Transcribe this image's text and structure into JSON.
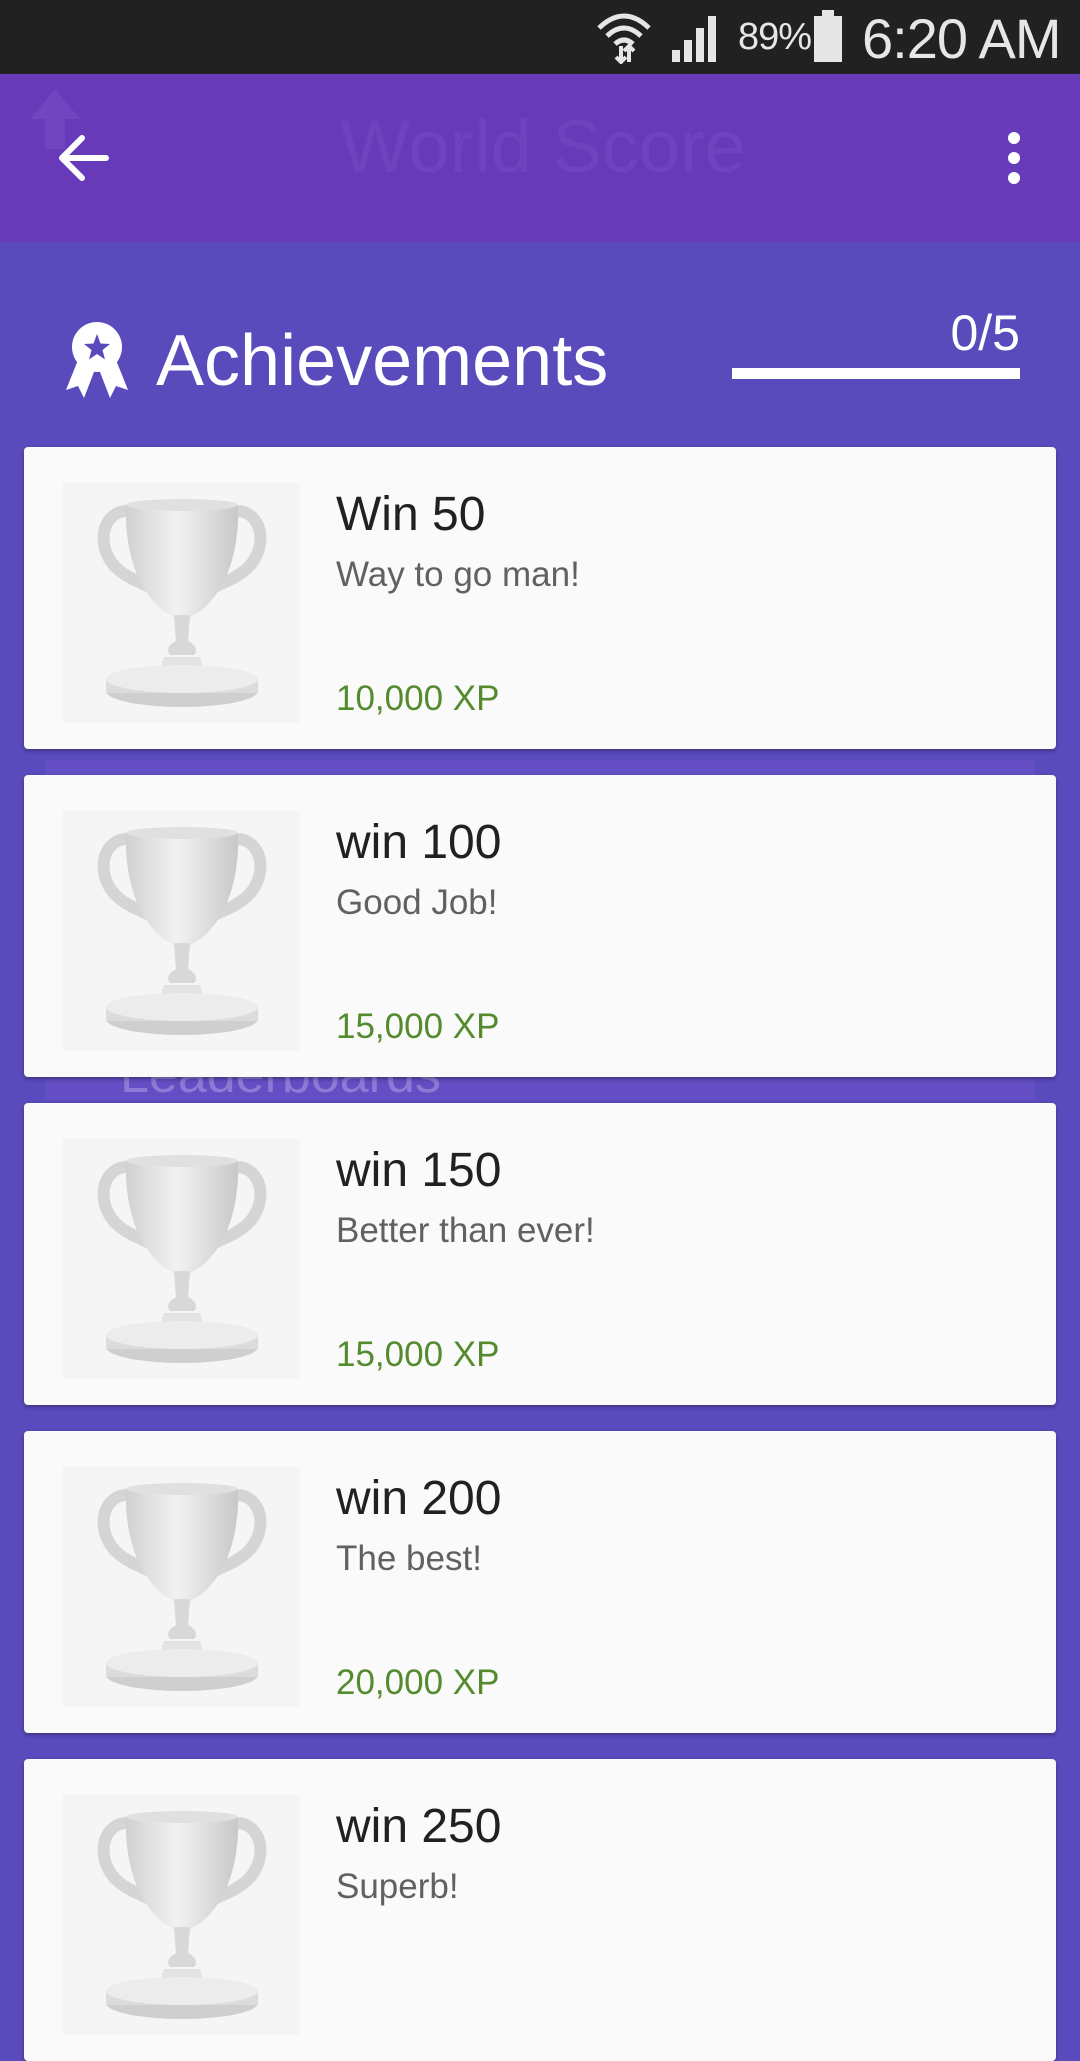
{
  "status_bar": {
    "battery_percent": "89%",
    "time": "6:20 AM",
    "icons": [
      "wifi-icon",
      "signal-icon",
      "battery-icon"
    ]
  },
  "app_bar": {
    "title": "World Score",
    "back_icon": "arrow-back-icon",
    "menu_icon": "more-vert-icon",
    "color": "#673ab9"
  },
  "background_ghost": {
    "label": "Leaderboards"
  },
  "achievements": {
    "title": "Achievements",
    "icon": "award-ribbon-icon",
    "progress_text": "0/5",
    "progress_fraction": 0,
    "items": [
      {
        "name": "Win 50",
        "description": "Way to go man!",
        "xp": "10,000 XP",
        "icon": "trophy-icon"
      },
      {
        "name": "win 100",
        "description": "Good Job!",
        "xp": "15,000 XP",
        "icon": "trophy-icon"
      },
      {
        "name": "win 150",
        "description": "Better than ever!",
        "xp": "15,000 XP",
        "icon": "trophy-icon"
      },
      {
        "name": "win 200",
        "description": "The best!",
        "xp": "20,000 XP",
        "icon": "trophy-icon"
      },
      {
        "name": "win 250",
        "description": "Superb!",
        "xp": "",
        "icon": "trophy-icon"
      }
    ]
  },
  "colors": {
    "background": "#5a4bbd",
    "xp_text": "#558b2f",
    "card": "#fafafa"
  }
}
